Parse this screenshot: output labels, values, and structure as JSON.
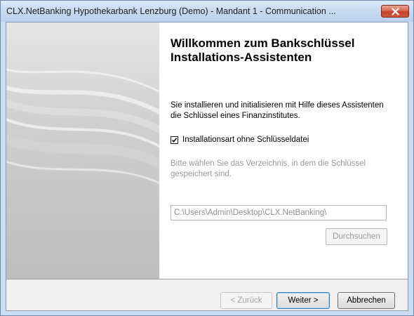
{
  "window": {
    "title": "CLX.NetBanking Hypothekarbank Lenzburg (Demo) - Mandant 1 - Communication ...",
    "close_icon": "close-icon"
  },
  "wizard": {
    "heading": "Willkommen zum Bankschlüssel Installations-Assistenten",
    "description": "Sie installieren und initialisieren mit Hilfe dieses Assistenten die Schlüssel eines Finanzinstitutes.",
    "checkbox": {
      "label": "Installationsart ohne Schlüsseldatei",
      "checked": true
    },
    "hint": "Bitte wählen Sie das Verzeichnis, in dem die Schlüssel gespeichert sind.",
    "path_value": "C:\\Users\\Admin\\Desktop\\CLX.NetBanking\\",
    "browse_label": "Durchsuchen"
  },
  "buttons": {
    "back": "< Zurück",
    "next": "Weiter >",
    "cancel": "Abbrechen"
  }
}
